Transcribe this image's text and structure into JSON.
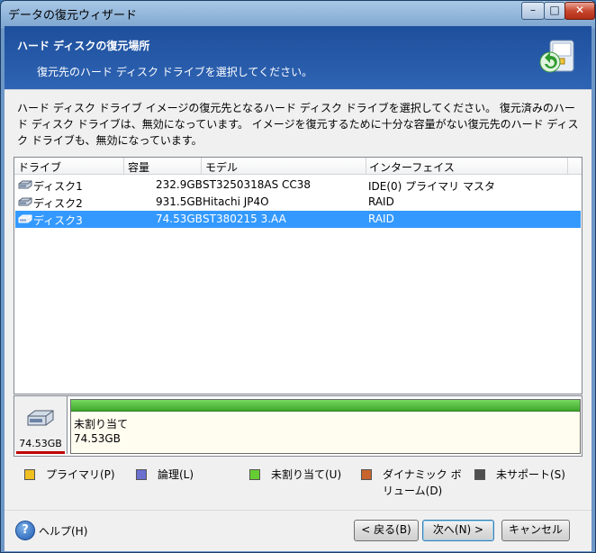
{
  "window": {
    "title": "データの復元ウィザード",
    "minimize_glyph": "–",
    "maximize_glyph": "□",
    "close_glyph": "✕"
  },
  "header": {
    "title": "ハード ディスクの復元場所",
    "subtitle": "復元先のハード ディスク ドライブを選択してください。",
    "icon": "disk-restore-icon"
  },
  "description": "ハード ディスク ドライブ イメージの復元先となるハード ディスク ドライブを選択してください。 復元済みのハード ディスク ドライブは、無効になっています。 イメージを復元するために十分な容量がない復元先のハード ディスク ドライブも、無効になっています。",
  "list": {
    "columns": [
      "ドライブ",
      "容量",
      "モデル",
      "インターフェイス"
    ],
    "rows": [
      {
        "drive": "ディスク1",
        "capacity": "232.9GB",
        "model": "ST3250318AS CC38",
        "interface": "IDE(0) プライマリ マスタ",
        "selected": false
      },
      {
        "drive": "ディスク2",
        "capacity": "931.5GB",
        "model": "Hitachi JP4O",
        "interface": "RAID",
        "selected": false
      },
      {
        "drive": "ディスク3",
        "capacity": "74.53GB",
        "model": "ST380215 3.AA",
        "interface": "RAID",
        "selected": true
      }
    ]
  },
  "disk_map": {
    "disk_size": "74.53GB",
    "partition_label": "未割り当て",
    "partition_size": "74.53GB"
  },
  "legend": [
    {
      "label": "プライマリ(P)",
      "color": "#f0c020"
    },
    {
      "label": "論理(L)",
      "color": "#6a6fd0"
    },
    {
      "label": "未割り当て(U)",
      "color": "#66cc33"
    },
    {
      "label": "ダイナミック ボリューム(D)",
      "line1": "ダイナミック ボ",
      "line2": "リューム(D)",
      "color": "#c8642c"
    },
    {
      "label": "未サポート(S)",
      "color": "#505050"
    }
  ],
  "footer": {
    "help": "ヘルプ(H)",
    "back": "< 戻る(B)",
    "next": "次へ(N) >",
    "cancel": "キャンセル"
  },
  "colors": {
    "selection": "#3399ff",
    "header_bg": "#2a5caa"
  }
}
